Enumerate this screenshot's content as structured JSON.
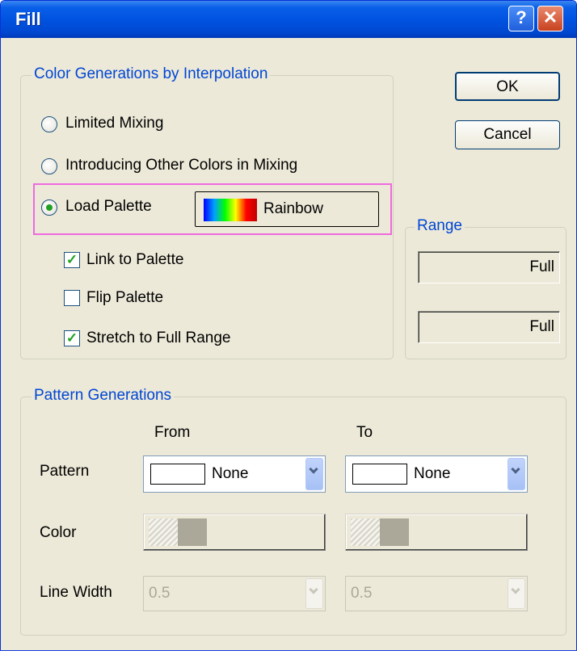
{
  "window": {
    "title": "Fill",
    "help_glyph": "?",
    "close_glyph": "✕"
  },
  "buttons": {
    "ok": "OK",
    "cancel": "Cancel"
  },
  "interpolation_group": {
    "legend": "Color Generations by Interpolation",
    "options": [
      "Limited Mixing",
      "Introducing Other Colors in Mixing",
      "Load Palette"
    ],
    "selected": "Load Palette",
    "palette_button": {
      "name": "Rainbow",
      "gradient": [
        "#0000ff",
        "#00a0ff",
        "#00ff00",
        "#ffff00",
        "#ff0000",
        "#c00000"
      ]
    },
    "checkboxes": [
      {
        "label": "Link to Palette",
        "checked": true
      },
      {
        "label": "Flip Palette",
        "checked": false
      },
      {
        "label": "Stretch to Full Range",
        "checked": true
      }
    ],
    "check_glyph": "✓"
  },
  "range_group": {
    "legend": "Range",
    "values": [
      "Full",
      "Full"
    ]
  },
  "pattern_group": {
    "legend": "Pattern Generations",
    "col_from": "From",
    "col_to": "To",
    "rows": {
      "pattern": "Pattern",
      "color": "Color",
      "line_width": "Line Width"
    },
    "pattern_from": "None",
    "pattern_to": "None",
    "line_width_from": "0.5",
    "line_width_to": "0.5"
  },
  "colors": {
    "accent": "#0046d5",
    "highlight": "#ef6ae0",
    "check": "#21a121"
  }
}
